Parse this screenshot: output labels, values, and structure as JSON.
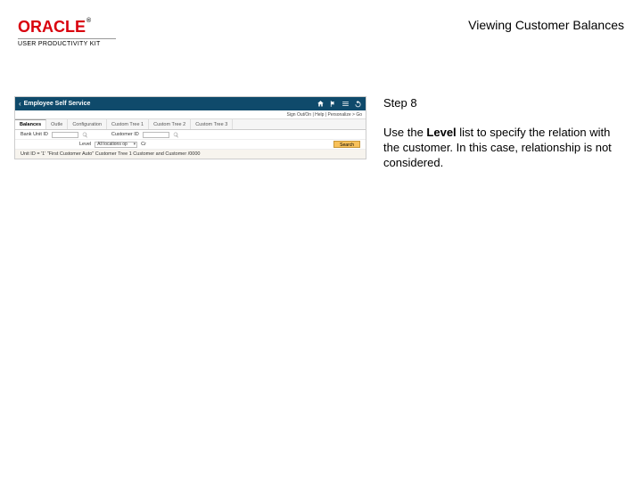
{
  "header": {
    "brand": "ORACLE",
    "brand_tm": "®",
    "subbrand": "USER PRODUCTIVITY KIT",
    "page_title": "Viewing Customer Balances"
  },
  "instructions": {
    "step_label": "Step 8",
    "text_before": "Use the ",
    "bold": "Level",
    "text_after": " list to specify the relation with the customer. In this case, relationship is not considered."
  },
  "app": {
    "title": "Employee Self Service",
    "top_links": "Sign Out/On | Help | Personalize > Go",
    "tabs": [
      {
        "label": "Balances",
        "active": true
      },
      {
        "label": "Outle"
      },
      {
        "label": "Configuration"
      },
      {
        "label": "Custom Tree 1"
      },
      {
        "label": "Custom Tree 2"
      },
      {
        "label": "Custom Tree 3"
      }
    ],
    "row1": {
      "label1": "Bank Unit ID",
      "label2": "Customer ID"
    },
    "row2": {
      "label1": "Level",
      "dropdown_value": "All locations op",
      "label_corr": "Cr",
      "search": "Search"
    },
    "criteria": "Unit ID = '1'   \"First Customer Auto\"   Customer Tree 1 Customer and Customer   /0000"
  }
}
